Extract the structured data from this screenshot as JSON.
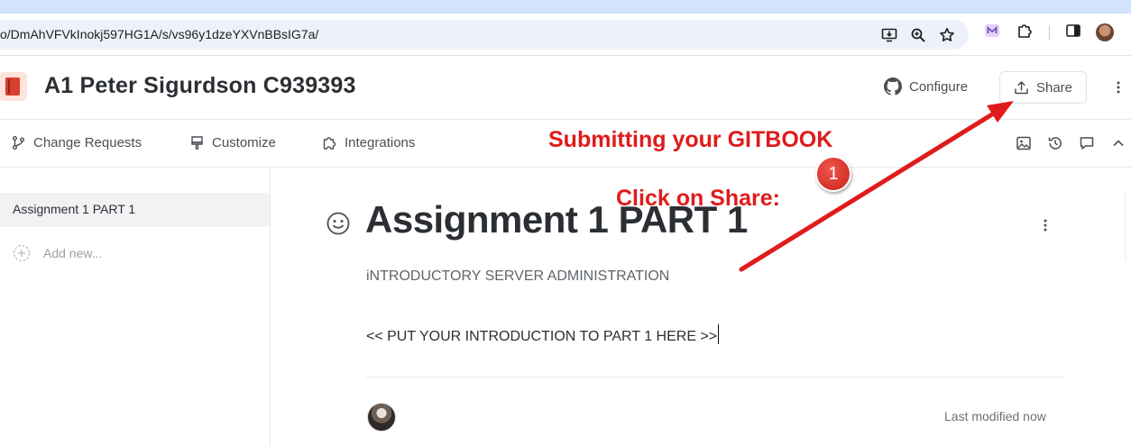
{
  "browser": {
    "url": "o/DmAhVFVkInokj597HG1A/s/vs96y1dzeYXVnBBsIG7a/",
    "icons": [
      "install-icon",
      "zoom-icon",
      "bookmark-star-icon",
      "extension-m-icon",
      "puzzle-icon",
      "sidepanel-icon",
      "profile-avatar"
    ]
  },
  "header": {
    "space_title": "A1 Peter Sigurdson C939393",
    "configure_label": "Configure",
    "share_label": "Share"
  },
  "toolbar": {
    "change_requests_label": "Change Requests",
    "customize_label": "Customize",
    "integrations_label": "Integrations"
  },
  "sidebar": {
    "items": [
      {
        "label": "Assignment 1 PART 1",
        "active": true
      }
    ],
    "add_new_label": "Add new..."
  },
  "page": {
    "title": "Assignment 1 PART 1",
    "subtitle": "iNTRODUCTORY SERVER ADMINISTRATION",
    "body": "<< PUT YOUR INTRODUCTION TO PART 1 HERE >>",
    "last_modified": "Last modified now"
  },
  "annotations": {
    "heading": "Submitting your GITBOOK",
    "instruction": "Click on Share:",
    "step_number": "1",
    "color": "#e01b1b"
  }
}
